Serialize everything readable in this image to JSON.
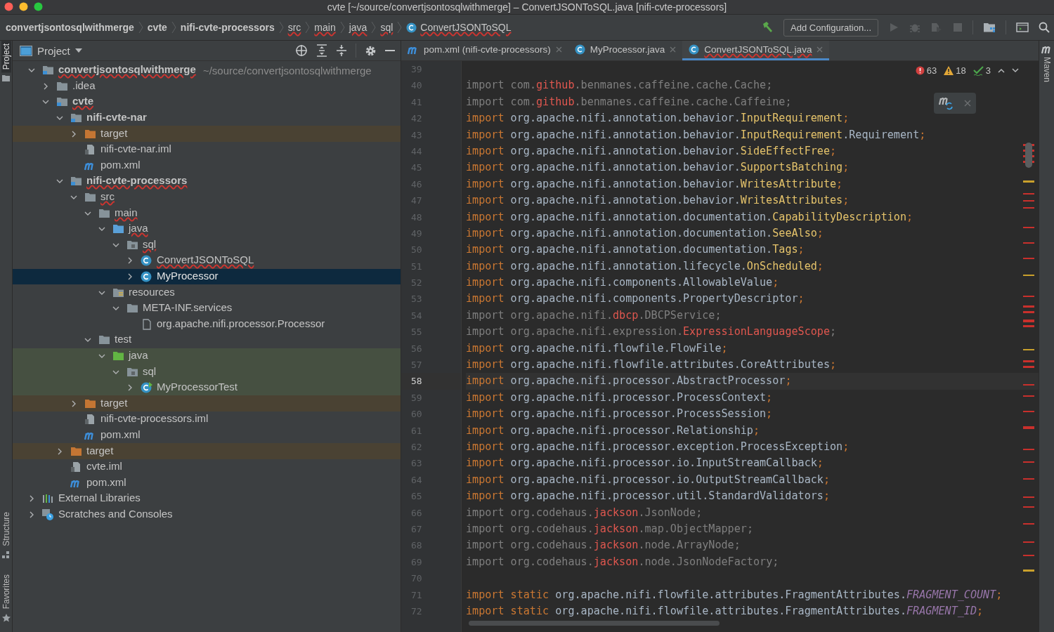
{
  "window": {
    "title": "cvte [~/source/convertjsontosqlwithmerge] – ConvertJSONToSQL.java [nifi-cvte-processors]"
  },
  "breadcrumbs": [
    {
      "label": "convertjsontosqlwithmerge",
      "bold": true,
      "error": false,
      "kind": "folder"
    },
    {
      "label": "cvte",
      "bold": true,
      "error": false,
      "kind": "folder"
    },
    {
      "label": "nifi-cvte-processors",
      "bold": true,
      "error": false,
      "kind": "folder"
    },
    {
      "label": "src",
      "bold": false,
      "error": true,
      "kind": "folder"
    },
    {
      "label": "main",
      "bold": false,
      "error": true,
      "kind": "folder"
    },
    {
      "label": "java",
      "bold": false,
      "error": true,
      "kind": "folder"
    },
    {
      "label": "sql",
      "bold": false,
      "error": true,
      "kind": "folder"
    },
    {
      "label": "ConvertJSONToSQL",
      "bold": false,
      "error": true,
      "kind": "class"
    }
  ],
  "toolbar": {
    "run_configuration": "Add Configuration..."
  },
  "tool_windows_left": [
    {
      "label": "Project",
      "selected": true,
      "kind": "project"
    },
    {
      "label": "Structure",
      "selected": false,
      "kind": "structure"
    },
    {
      "label": "Favorites",
      "selected": false,
      "kind": "favorites"
    }
  ],
  "tool_windows_right": [
    {
      "label": "Maven",
      "selected": false
    }
  ],
  "project_panel": {
    "title": "Project"
  },
  "tree": [
    {
      "label": "convertjsontosqlwithmerge",
      "note": "~/source/convertjsontosqlwithmerge",
      "kind": "module",
      "bold": true,
      "error": true,
      "expanded": true,
      "selected": false,
      "children": [
        {
          "label": ".idea",
          "kind": "folder",
          "bold": false,
          "error": false,
          "expanded": false,
          "selected": false
        },
        {
          "label": "cvte",
          "kind": "module",
          "bold": true,
          "error": true,
          "expanded": true,
          "selected": false,
          "children": [
            {
              "label": "nifi-cvte-nar",
              "kind": "module",
              "bold": true,
              "error": false,
              "expanded": true,
              "selected": false,
              "children": [
                {
                  "label": "target",
                  "kind": "excluded",
                  "bold": false,
                  "error": false,
                  "expanded": false,
                  "selected": false
                },
                {
                  "label": "nifi-cvte-nar.iml",
                  "kind": "iml",
                  "bold": false,
                  "error": false,
                  "selected": false
                },
                {
                  "label": "pom.xml",
                  "kind": "maven",
                  "bold": false,
                  "error": false,
                  "selected": false
                }
              ]
            },
            {
              "label": "nifi-cvte-processors",
              "kind": "module",
              "bold": true,
              "error": true,
              "expanded": true,
              "selected": false,
              "children": [
                {
                  "label": "src",
                  "kind": "folder",
                  "bold": false,
                  "error": true,
                  "expanded": true,
                  "selected": false,
                  "children": [
                    {
                      "label": "main",
                      "kind": "folder",
                      "bold": false,
                      "error": true,
                      "expanded": true,
                      "selected": false,
                      "children": [
                        {
                          "label": "java",
                          "kind": "source",
                          "bold": false,
                          "error": true,
                          "expanded": true,
                          "selected": false,
                          "children": [
                            {
                              "label": "sql",
                              "kind": "package",
                              "bold": false,
                              "error": true,
                              "expanded": true,
                              "selected": false,
                              "children": [
                                {
                                  "label": "ConvertJSONToSQL",
                                  "kind": "class",
                                  "bold": false,
                                  "error": true,
                                  "expanded": false,
                                  "selected": false
                                },
                                {
                                  "label": "MyProcessor",
                                  "kind": "class",
                                  "bold": false,
                                  "error": false,
                                  "expanded": false,
                                  "selected": true
                                }
                              ]
                            }
                          ]
                        },
                        {
                          "label": "resources",
                          "kind": "resources",
                          "bold": false,
                          "error": false,
                          "expanded": true,
                          "selected": false,
                          "children": [
                            {
                              "label": "META-INF.services",
                              "kind": "folder",
                              "bold": false,
                              "error": false,
                              "expanded": true,
                              "selected": false,
                              "children": [
                                {
                                  "label": "org.apache.nifi.processor.Processor",
                                  "kind": "file",
                                  "bold": false,
                                  "error": false,
                                  "selected": false
                                }
                              ]
                            }
                          ]
                        }
                      ]
                    },
                    {
                      "label": "test",
                      "kind": "folder",
                      "bold": false,
                      "error": false,
                      "expanded": true,
                      "selected": false,
                      "children": [
                        {
                          "label": "java",
                          "kind": "test-source",
                          "bold": false,
                          "error": false,
                          "expanded": true,
                          "selected": false,
                          "children": [
                            {
                              "label": "sql",
                              "kind": "test-package",
                              "bold": false,
                              "error": false,
                              "expanded": true,
                              "selected": false,
                              "children": [
                                {
                                  "label": "MyProcessorTest",
                                  "kind": "test-class",
                                  "bold": false,
                                  "error": false,
                                  "expanded": false,
                                  "selected": false
                                }
                              ]
                            }
                          ]
                        }
                      ]
                    }
                  ]
                },
                {
                  "label": "target",
                  "kind": "excluded",
                  "bold": false,
                  "error": false,
                  "expanded": false,
                  "selected": false
                },
                {
                  "label": "nifi-cvte-processors.iml",
                  "kind": "iml",
                  "bold": false,
                  "error": false,
                  "selected": false
                },
                {
                  "label": "pom.xml",
                  "kind": "maven",
                  "bold": false,
                  "error": false,
                  "selected": false
                }
              ]
            },
            {
              "label": "target",
              "kind": "excluded",
              "bold": false,
              "error": false,
              "expanded": false,
              "selected": false
            },
            {
              "label": "cvte.iml",
              "kind": "iml",
              "bold": false,
              "error": false,
              "selected": false
            },
            {
              "label": "pom.xml",
              "kind": "maven",
              "bold": false,
              "error": false,
              "selected": false
            }
          ]
        }
      ]
    },
    {
      "label": "External Libraries",
      "kind": "libraries",
      "bold": false,
      "error": false,
      "expanded": false,
      "selected": false
    },
    {
      "label": "Scratches and Consoles",
      "kind": "scratches",
      "bold": false,
      "error": false,
      "expanded": false,
      "selected": false
    }
  ],
  "tabs": [
    {
      "label": "pom.xml (nifi-cvte-processors)",
      "kind": "maven",
      "error": false,
      "selected": false
    },
    {
      "label": "MyProcessor.java",
      "kind": "class",
      "error": false,
      "selected": false
    },
    {
      "label": "ConvertJSONToSQL.java",
      "kind": "class",
      "error": true,
      "selected": true
    }
  ],
  "inspections": [
    {
      "kind": "error",
      "count": "63"
    },
    {
      "kind": "warning",
      "count": "18"
    },
    {
      "kind": "typo",
      "count": "3"
    }
  ],
  "code": [
    {
      "n": "39"
    },
    {
      "n": "40",
      "unused": true,
      "current": false,
      "parts": [
        {
          "kind": "kw",
          "t": "import"
        },
        {
          "kind": "plain",
          "t": " com."
        },
        {
          "kind": "err",
          "t": "github"
        },
        {
          "kind": "plain",
          "t": ".benmanes.caffeine.cache.Cache"
        },
        {
          "kind": "punct",
          "t": ";"
        }
      ]
    },
    {
      "n": "41",
      "unused": true,
      "current": false,
      "parts": [
        {
          "kind": "kw",
          "t": "import"
        },
        {
          "kind": "plain",
          "t": " com."
        },
        {
          "kind": "err",
          "t": "github"
        },
        {
          "kind": "plain",
          "t": ".benmanes.caffeine.cache.Caffeine"
        },
        {
          "kind": "punct",
          "t": ";"
        }
      ]
    },
    {
      "n": "42",
      "unused": false,
      "current": false,
      "parts": [
        {
          "kind": "kw",
          "t": "import"
        },
        {
          "kind": "plain",
          "t": " org.apache.nifi.annotation.behavior."
        },
        {
          "kind": "sym",
          "t": "InputRequirement"
        },
        {
          "kind": "punct",
          "t": ";"
        }
      ]
    },
    {
      "n": "43",
      "unused": false,
      "current": false,
      "parts": [
        {
          "kind": "kw",
          "t": "import"
        },
        {
          "kind": "plain",
          "t": " org.apache.nifi.annotation.behavior."
        },
        {
          "kind": "sym",
          "t": "InputRequirement"
        },
        {
          "kind": "plain",
          "t": ".Requirement"
        },
        {
          "kind": "punct",
          "t": ";"
        }
      ]
    },
    {
      "n": "44",
      "unused": false,
      "current": false,
      "parts": [
        {
          "kind": "kw",
          "t": "import"
        },
        {
          "kind": "plain",
          "t": " org.apache.nifi.annotation.behavior."
        },
        {
          "kind": "sym",
          "t": "SideEffectFree"
        },
        {
          "kind": "punct",
          "t": ";"
        }
      ]
    },
    {
      "n": "45",
      "unused": false,
      "current": false,
      "parts": [
        {
          "kind": "kw",
          "t": "import"
        },
        {
          "kind": "plain",
          "t": " org.apache.nifi.annotation.behavior."
        },
        {
          "kind": "sym",
          "t": "SupportsBatching"
        },
        {
          "kind": "punct",
          "t": ";"
        }
      ]
    },
    {
      "n": "46",
      "unused": false,
      "current": false,
      "parts": [
        {
          "kind": "kw",
          "t": "import"
        },
        {
          "kind": "plain",
          "t": " org.apache.nifi.annotation.behavior."
        },
        {
          "kind": "sym",
          "t": "WritesAttribute"
        },
        {
          "kind": "punct",
          "t": ";"
        }
      ]
    },
    {
      "n": "47",
      "unused": false,
      "current": false,
      "parts": [
        {
          "kind": "kw",
          "t": "import"
        },
        {
          "kind": "plain",
          "t": " org.apache.nifi.annotation.behavior."
        },
        {
          "kind": "sym",
          "t": "WritesAttributes"
        },
        {
          "kind": "punct",
          "t": ";"
        }
      ]
    },
    {
      "n": "48",
      "unused": false,
      "current": false,
      "parts": [
        {
          "kind": "kw",
          "t": "import"
        },
        {
          "kind": "plain",
          "t": " org.apache.nifi.annotation.documentation."
        },
        {
          "kind": "sym",
          "t": "CapabilityDescription"
        },
        {
          "kind": "punct",
          "t": ";"
        }
      ]
    },
    {
      "n": "49",
      "unused": false,
      "current": false,
      "parts": [
        {
          "kind": "kw",
          "t": "import"
        },
        {
          "kind": "plain",
          "t": " org.apache.nifi.annotation.documentation."
        },
        {
          "kind": "sym",
          "t": "SeeAlso"
        },
        {
          "kind": "punct",
          "t": ";"
        }
      ]
    },
    {
      "n": "50",
      "unused": false,
      "current": false,
      "parts": [
        {
          "kind": "kw",
          "t": "import"
        },
        {
          "kind": "plain",
          "t": " org.apache.nifi.annotation.documentation."
        },
        {
          "kind": "sym",
          "t": "Tags"
        },
        {
          "kind": "punct",
          "t": ";"
        }
      ]
    },
    {
      "n": "51",
      "unused": false,
      "current": false,
      "parts": [
        {
          "kind": "kw",
          "t": "import"
        },
        {
          "kind": "plain",
          "t": " org.apache.nifi.annotation.lifecycle."
        },
        {
          "kind": "sym",
          "t": "OnScheduled"
        },
        {
          "kind": "punct",
          "t": ";"
        }
      ]
    },
    {
      "n": "52",
      "unused": false,
      "current": false,
      "parts": [
        {
          "kind": "kw",
          "t": "import"
        },
        {
          "kind": "plain",
          "t": " org.apache.nifi.components.AllowableValue"
        },
        {
          "kind": "punct",
          "t": ";"
        }
      ]
    },
    {
      "n": "53",
      "unused": false,
      "current": false,
      "parts": [
        {
          "kind": "kw",
          "t": "import"
        },
        {
          "kind": "plain",
          "t": " org.apache.nifi.components.PropertyDescriptor"
        },
        {
          "kind": "punct",
          "t": ";"
        }
      ]
    },
    {
      "n": "54",
      "unused": true,
      "current": false,
      "parts": [
        {
          "kind": "kw",
          "t": "import"
        },
        {
          "kind": "plain",
          "t": " org.apache.nifi."
        },
        {
          "kind": "err",
          "t": "dbcp"
        },
        {
          "kind": "plain",
          "t": ".DBCPService"
        },
        {
          "kind": "punct",
          "t": ";"
        }
      ]
    },
    {
      "n": "55",
      "unused": true,
      "current": false,
      "parts": [
        {
          "kind": "kw",
          "t": "import"
        },
        {
          "kind": "plain",
          "t": " org.apache.nifi.expression."
        },
        {
          "kind": "err",
          "t": "ExpressionLanguageScope"
        },
        {
          "kind": "punct",
          "t": ";"
        }
      ]
    },
    {
      "n": "56",
      "unused": false,
      "current": false,
      "parts": [
        {
          "kind": "kw",
          "t": "import"
        },
        {
          "kind": "plain",
          "t": " org.apache.nifi.flowfile.FlowFile"
        },
        {
          "kind": "punct",
          "t": ";"
        }
      ]
    },
    {
      "n": "57",
      "unused": false,
      "current": false,
      "parts": [
        {
          "kind": "kw",
          "t": "import"
        },
        {
          "kind": "plain",
          "t": " org.apache.nifi.flowfile.attributes.CoreAttributes"
        },
        {
          "kind": "punct",
          "t": ";"
        }
      ]
    },
    {
      "n": "58",
      "unused": false,
      "current": true,
      "parts": [
        {
          "kind": "kw",
          "t": "import"
        },
        {
          "kind": "plain",
          "t": " org.apache.nifi.processor.AbstractProcessor"
        },
        {
          "kind": "punct",
          "t": ";"
        }
      ]
    },
    {
      "n": "59",
      "unused": false,
      "current": false,
      "parts": [
        {
          "kind": "kw",
          "t": "import"
        },
        {
          "kind": "plain",
          "t": " org.apache.nifi.processor.ProcessContext"
        },
        {
          "kind": "punct",
          "t": ";"
        }
      ]
    },
    {
      "n": "60",
      "unused": false,
      "current": false,
      "parts": [
        {
          "kind": "kw",
          "t": "import"
        },
        {
          "kind": "plain",
          "t": " org.apache.nifi.processor.ProcessSession"
        },
        {
          "kind": "punct",
          "t": ";"
        }
      ]
    },
    {
      "n": "61",
      "unused": false,
      "current": false,
      "parts": [
        {
          "kind": "kw",
          "t": "import"
        },
        {
          "kind": "plain",
          "t": " org.apache.nifi.processor.Relationship"
        },
        {
          "kind": "punct",
          "t": ";"
        }
      ]
    },
    {
      "n": "62",
      "unused": false,
      "current": false,
      "parts": [
        {
          "kind": "kw",
          "t": "import"
        },
        {
          "kind": "plain",
          "t": " org.apache.nifi.processor.exception.ProcessException"
        },
        {
          "kind": "punct",
          "t": ";"
        }
      ]
    },
    {
      "n": "63",
      "unused": false,
      "current": false,
      "parts": [
        {
          "kind": "kw",
          "t": "import"
        },
        {
          "kind": "plain",
          "t": " org.apache.nifi.processor.io.InputStreamCallback"
        },
        {
          "kind": "punct",
          "t": ";"
        }
      ]
    },
    {
      "n": "64",
      "unused": false,
      "current": false,
      "parts": [
        {
          "kind": "kw",
          "t": "import"
        },
        {
          "kind": "plain",
          "t": " org.apache.nifi.processor.io.OutputStreamCallback"
        },
        {
          "kind": "punct",
          "t": ";"
        }
      ]
    },
    {
      "n": "65",
      "unused": false,
      "current": false,
      "parts": [
        {
          "kind": "kw",
          "t": "import"
        },
        {
          "kind": "plain",
          "t": " org.apache.nifi.processor.util.StandardValidators"
        },
        {
          "kind": "punct",
          "t": ";"
        }
      ]
    },
    {
      "n": "66",
      "unused": true,
      "current": false,
      "parts": [
        {
          "kind": "kw",
          "t": "import"
        },
        {
          "kind": "plain",
          "t": " org.codehaus."
        },
        {
          "kind": "err",
          "t": "jackson"
        },
        {
          "kind": "plain",
          "t": ".JsonNode"
        },
        {
          "kind": "punct",
          "t": ";"
        }
      ]
    },
    {
      "n": "67",
      "unused": true,
      "current": false,
      "parts": [
        {
          "kind": "kw",
          "t": "import"
        },
        {
          "kind": "plain",
          "t": " org.codehaus."
        },
        {
          "kind": "err",
          "t": "jackson"
        },
        {
          "kind": "plain",
          "t": ".map.ObjectMapper"
        },
        {
          "kind": "punct",
          "t": ";"
        }
      ]
    },
    {
      "n": "68",
      "unused": true,
      "current": false,
      "parts": [
        {
          "kind": "kw",
          "t": "import"
        },
        {
          "kind": "plain",
          "t": " org.codehaus."
        },
        {
          "kind": "err",
          "t": "jackson"
        },
        {
          "kind": "plain",
          "t": ".node.ArrayNode"
        },
        {
          "kind": "punct",
          "t": ";"
        }
      ]
    },
    {
      "n": "69",
      "unused": true,
      "current": false,
      "parts": [
        {
          "kind": "kw",
          "t": "import"
        },
        {
          "kind": "plain",
          "t": " org.codehaus."
        },
        {
          "kind": "err",
          "t": "jackson"
        },
        {
          "kind": "plain",
          "t": ".node.JsonNodeFactory"
        },
        {
          "kind": "punct",
          "t": ";"
        }
      ]
    },
    {
      "n": "70"
    },
    {
      "n": "71",
      "unused": false,
      "current": false,
      "parts": [
        {
          "kind": "kw",
          "t": "import static"
        },
        {
          "kind": "plain",
          "t": " org.apache.nifi.flowfile.attributes.FragmentAttributes."
        },
        {
          "kind": "const",
          "t": "FRAGMENT_COUNT"
        },
        {
          "kind": "punct",
          "t": ";"
        }
      ]
    },
    {
      "n": "72",
      "unused": false,
      "current": false,
      "parts": [
        {
          "kind": "kw",
          "t": "import static"
        },
        {
          "kind": "plain",
          "t": " org.apache.nifi.flowfile.attributes.FragmentAttributes."
        },
        {
          "kind": "const",
          "t": "FRAGMENT_ID"
        },
        {
          "kind": "punct",
          "t": ";"
        }
      ]
    }
  ]
}
